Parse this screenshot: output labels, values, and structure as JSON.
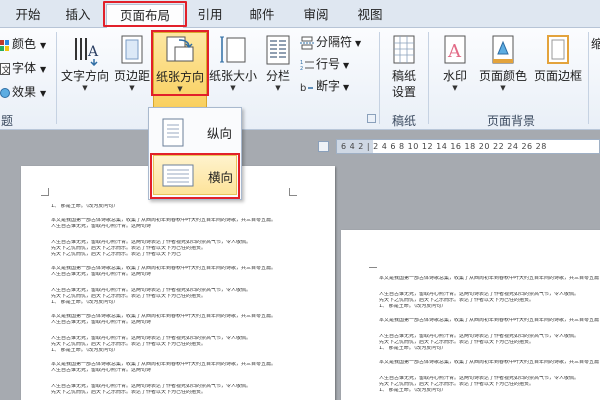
{
  "tabs": [
    {
      "label": "开始",
      "active": false
    },
    {
      "label": "插入",
      "active": false
    },
    {
      "label": "页面布局",
      "active": true
    },
    {
      "label": "引用",
      "active": false
    },
    {
      "label": "邮件",
      "active": false
    },
    {
      "label": "审阅",
      "active": false
    },
    {
      "label": "视图",
      "active": false
    }
  ],
  "ribbon": {
    "theme": {
      "colors": "颜色",
      "fonts": "字体",
      "effects": "效果",
      "group_label_fragment": "题"
    },
    "page_setup": {
      "text_direction": "文字方向",
      "margins": "页边距",
      "orientation": "纸张方向",
      "size": "纸张大小",
      "columns": "分栏",
      "breaks": "分隔符",
      "line_numbers": "行号",
      "hyphenation": "断字"
    },
    "manuscript": {
      "settings_line1": "稿纸",
      "settings_line2": "设置",
      "group_label": "稿纸"
    },
    "page_background": {
      "watermark": "水印",
      "page_color": "页面颜色",
      "page_borders": "页面边框",
      "group_label": "页面背景"
    },
    "partial_right": "缩"
  },
  "orientation_menu": {
    "portrait": "纵向",
    "landscape": "横向",
    "selected": "横向"
  },
  "ruler": {
    "numbers": "6 4 2 | 2 4 6 8 10 12 14 16 18 20 22 24 26 28"
  },
  "document": {
    "lines": [
      "1、 那是王命。（改为反问句）",
      "本文是我国第一部古体诗歌总集，收集了从西周初年到春秋中叶大约五百年间的诗歌，共三百零五篇。",
      "人生自古谁无死，留取丹心照汗青。这两句诗表达了作者视死如归的崇高气节，令人敬佩。",
      "先天下之忧而忧，后天下之乐而乐。表达了作者以天下为己任的抱负。",
      "1、 那是王命。（改为反问句）"
    ]
  },
  "colors": {
    "highlight": "#e2202a",
    "pressed": "#f9cf5d",
    "tab_bar": "#dfe7f1"
  }
}
